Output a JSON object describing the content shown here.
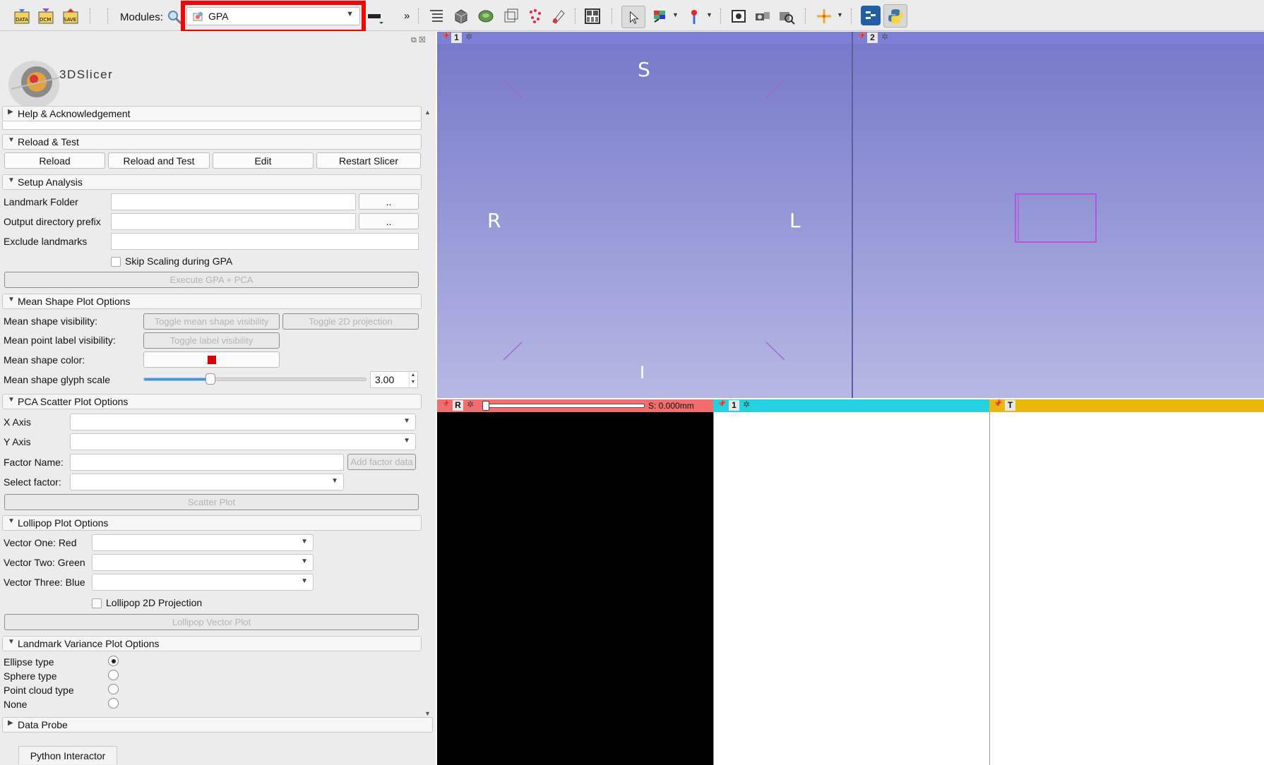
{
  "toolbar": {
    "data_icon_text": "DATA",
    "dcm_icon_text": "DCM",
    "save_icon_text": "SAVE",
    "modules_label": "Modules:",
    "selected_module": "GPA",
    "overflow_label": "»"
  },
  "app": {
    "logo_text": "3DSlicer"
  },
  "sections": {
    "help": "Help & Acknowledgement",
    "reload_test": "Reload & Test",
    "setup": "Setup Analysis",
    "mean_shape": "Mean Shape Plot Options",
    "pca": "PCA Scatter Plot Options",
    "lollipop": "Lollipop Plot Options",
    "landmark_variance": "Landmark Variance Plot Options",
    "data_probe": "Data Probe"
  },
  "reload": {
    "reload": "Reload",
    "reload_and_test": "Reload and Test",
    "edit": "Edit",
    "restart": "Restart Slicer"
  },
  "setup": {
    "landmark_folder": "Landmark Folder",
    "output_prefix": "Output directory prefix",
    "exclude": "Exclude landmarks",
    "browse": "..",
    "skip_scaling": "Skip Scaling during GPA",
    "execute": "Execute GPA + PCA"
  },
  "mean_shape": {
    "visibility_label": "Mean shape visibility:",
    "toggle_visibility": "Toggle mean shape visibility",
    "toggle_2d": "Toggle 2D projection",
    "label_visibility_label": "Mean point label visibility:",
    "toggle_label": "Toggle label visibility",
    "color_label": "Mean shape color:",
    "color": "#e00000",
    "glyph_label": "Mean shape glyph scale",
    "glyph_value": "3.00",
    "glyph_slider_fraction": 0.3
  },
  "pca": {
    "x_axis": "X Axis",
    "y_axis": "Y Axis",
    "factor_name": "Factor Name:",
    "add_factor": "Add factor data",
    "select_factor": "Select factor:",
    "scatter_plot": "Scatter Plot"
  },
  "lollipop": {
    "vector_one": "Vector One: Red",
    "vector_two": "Vector Two: Green",
    "vector_three": "Vector Three: Blue",
    "projection_2d": "Lollipop 2D Projection",
    "plot_button": "Lollipop Vector Plot"
  },
  "variance": {
    "ellipse": "Ellipse type",
    "sphere": "Sphere type",
    "point_cloud": "Point cloud type",
    "none": "None",
    "selected": "Ellipse type"
  },
  "bottom_tab": "Python Interactor",
  "views": {
    "view1_number": "1",
    "view2_number": "2",
    "superior": "S",
    "inferior": "I",
    "right": "R",
    "left": "L",
    "red_label": "R",
    "red_readout": "S: 0.000mm",
    "green_label": "1",
    "yellow_label": "T",
    "red_color": "#f36d6d",
    "cyan_color": "#22d2e0",
    "yellow_color": "#e9b80b"
  }
}
